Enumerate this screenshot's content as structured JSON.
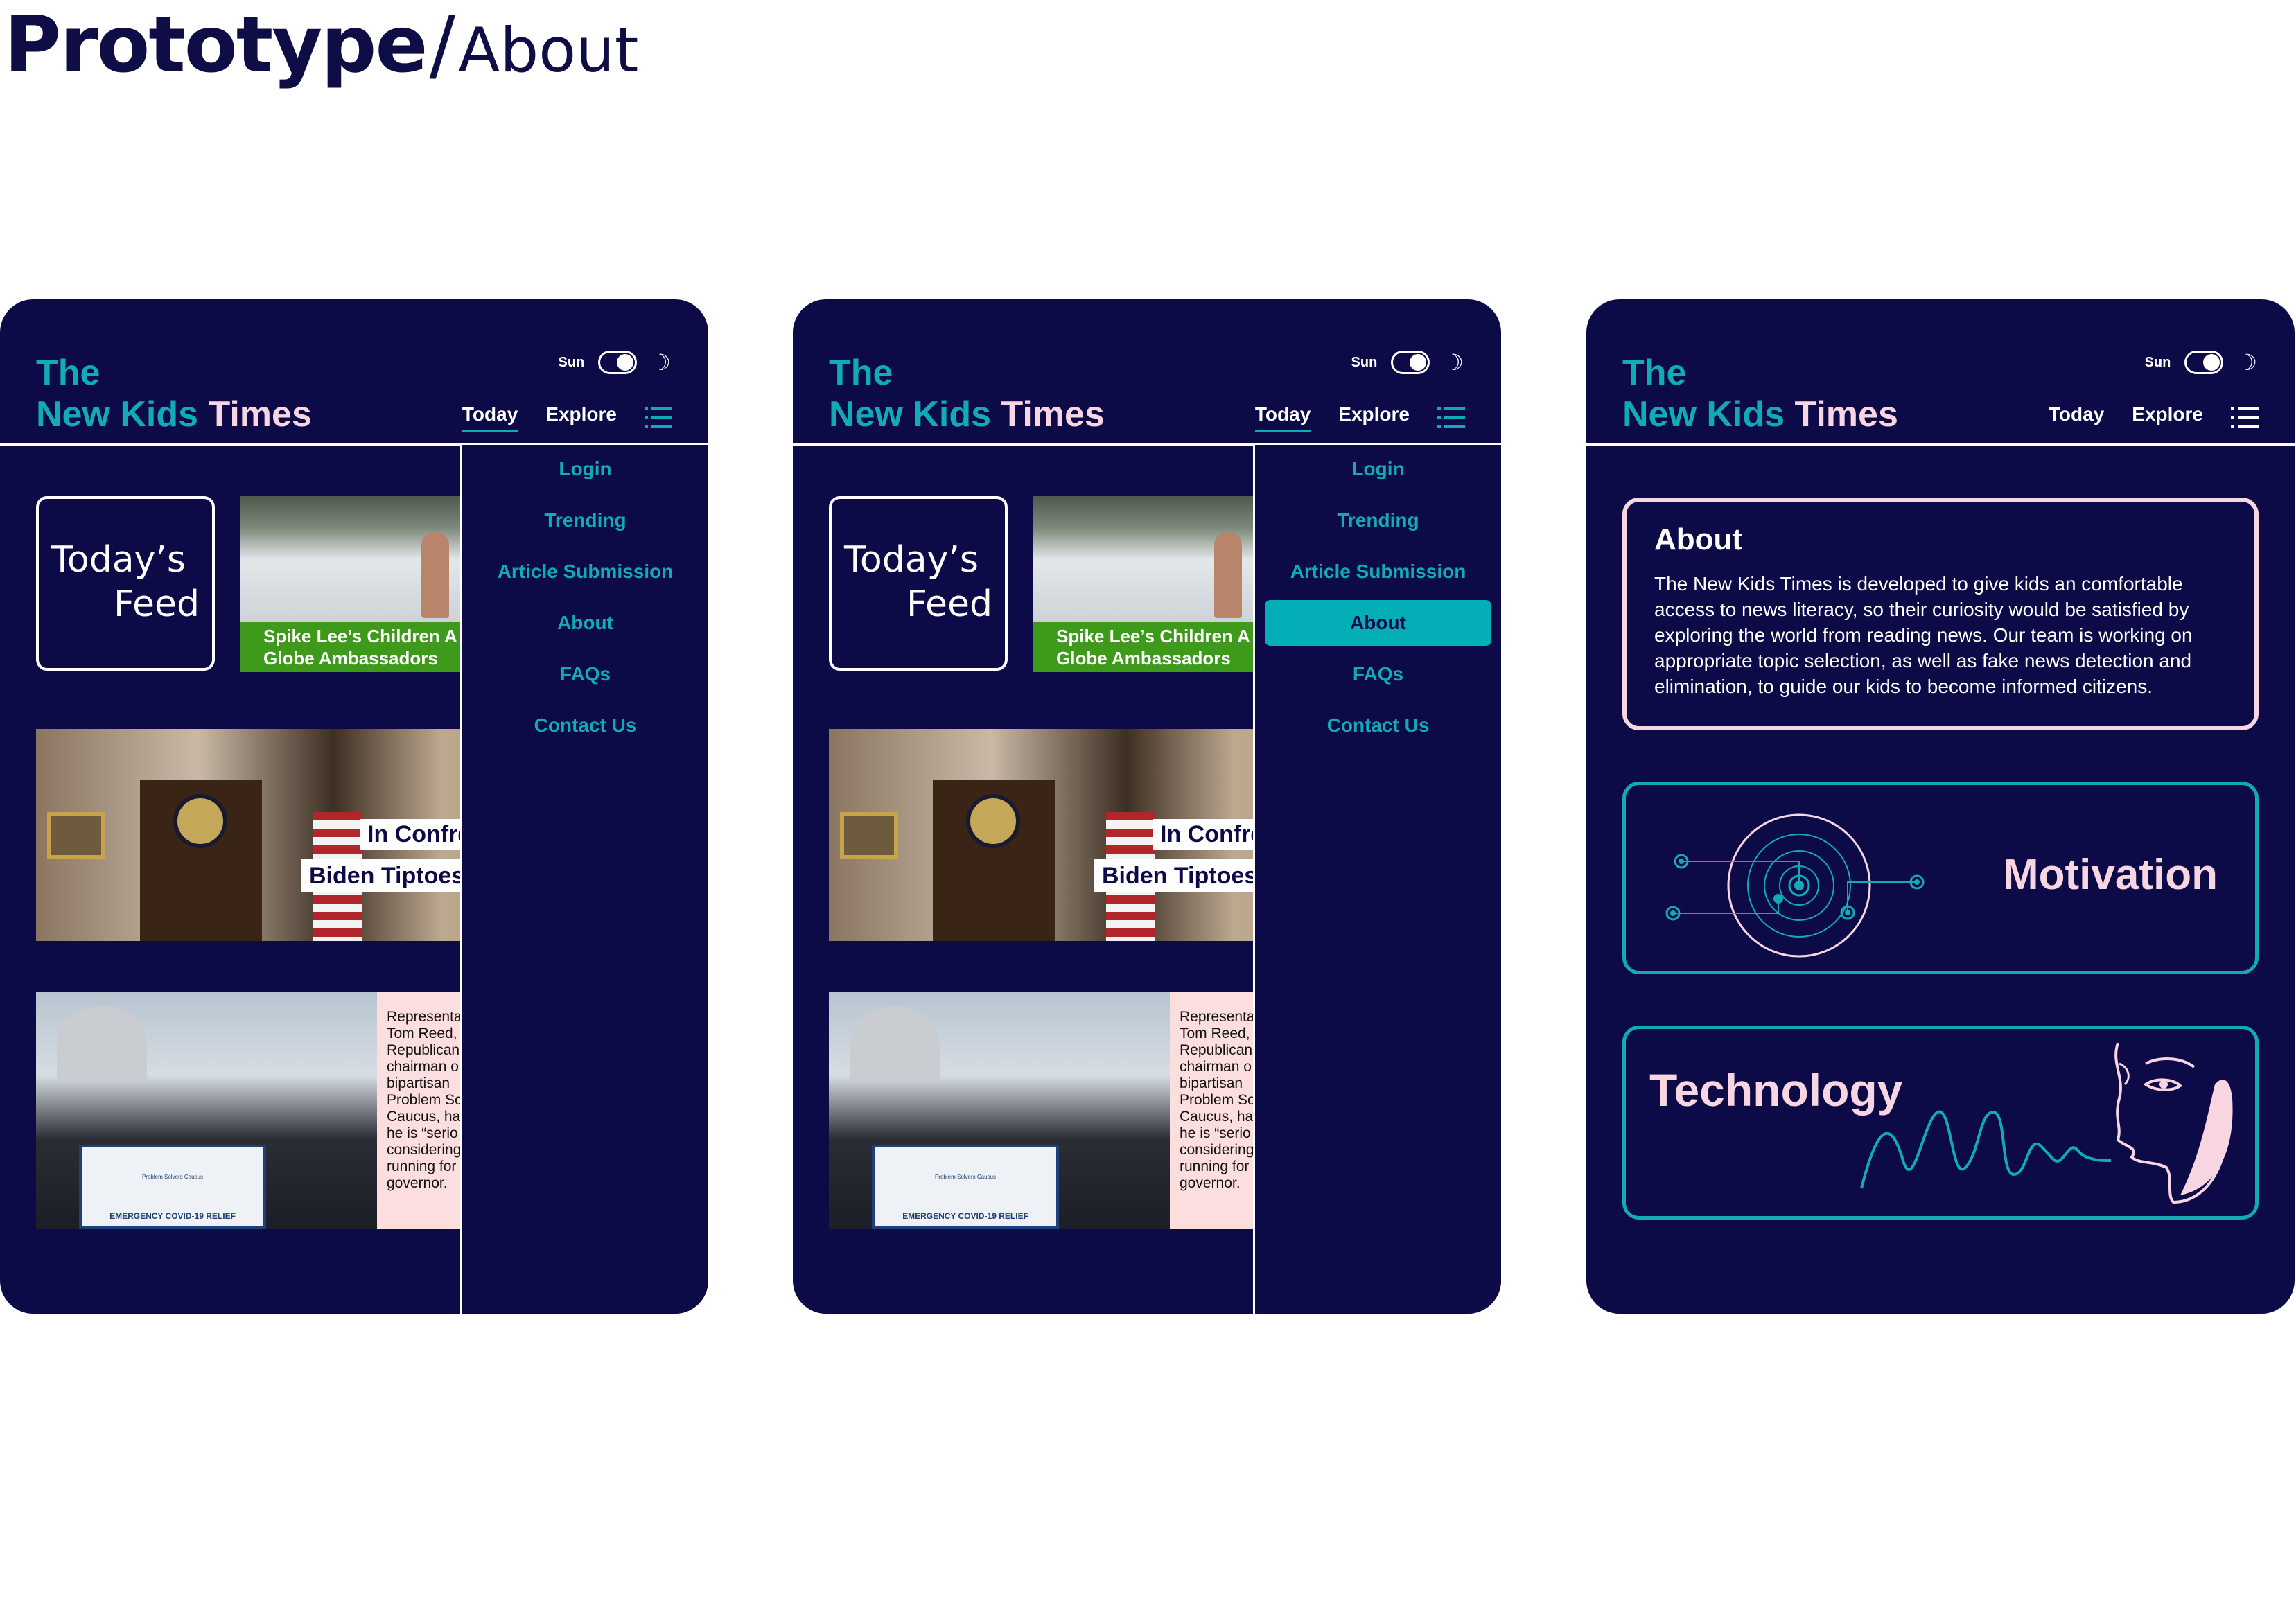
{
  "page": {
    "title_main": "Prototype",
    "separator": "/",
    "title_sub": "About"
  },
  "app": {
    "brand_line1": "The",
    "brand_line2a": "New Kids",
    "brand_line2b": "Times",
    "theme_label": "Sun",
    "moon_glyph": "☽",
    "nav": {
      "today": "Today",
      "explore": "Explore"
    }
  },
  "menu": {
    "items": [
      "Login",
      "Trending",
      "Article Submission",
      "About",
      "FAQs",
      "Contact Us"
    ],
    "selected_in_frame2": "About"
  },
  "feed": {
    "box_line1": "Today’s",
    "box_line2": "Feed",
    "card1_caption_line1": "Spike Lee’s Children A",
    "card1_caption_line2": "Globe Ambassadors",
    "card2_tag1": "In Confro",
    "card2_tag2": "Biden Tiptoes",
    "card3_lectern_org": "Problem Solvers Caucus",
    "card3_lectern_banner": "EMERGENCY COVID-19 RELIEF",
    "card3_text_lines": [
      "Representa",
      "Tom Reed,",
      "Republican",
      "chairman o",
      "bipartisan",
      "Problem So",
      "Caucus, ha",
      "he is “serio",
      "considering",
      "running for",
      "governor."
    ]
  },
  "about_page": {
    "heading": "About",
    "body": "The New Kids Times is developed to give kids an comfortable access to news literacy, so their curiosity would be satisfied by exploring the world from reading news. Our team is working on appropriate topic selection, as well as fake news detection and elimination, to guide our kids to become informed citizens.",
    "motivation": "Motivation",
    "technology": "Technology"
  },
  "colors": {
    "frame_bg": "#0d0b47",
    "teal": "#11aab7",
    "pink": "#f7d6e1",
    "selected_bg": "#03aeb6",
    "green_caption": "#3d9a1a"
  },
  "icons": [
    "toggle-switch",
    "moon-icon",
    "list-menu-icon",
    "radar-icon",
    "face-wave-icon"
  ]
}
